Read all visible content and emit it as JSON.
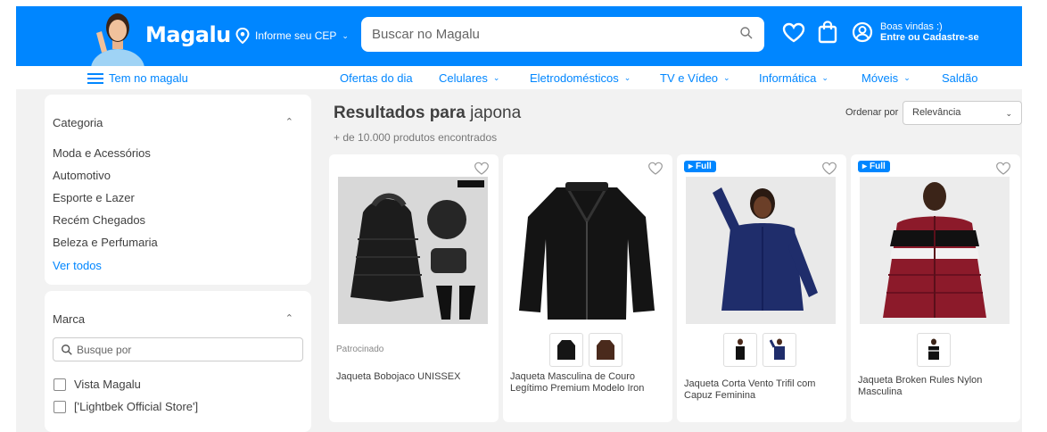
{
  "header": {
    "logo": "Magalu",
    "cep_label": "Informe seu CEP",
    "search_placeholder": "Buscar no Magalu",
    "greeting": "Boas vindas :)",
    "login_label": "Entre ou Cadastre-se",
    "brand_color": "#0086ff"
  },
  "nav": {
    "menu_label": "Tem no magalu",
    "items": [
      "Ofertas do dia",
      "Celulares",
      "Eletrodomésticos",
      "TV e Vídeo",
      "Informática",
      "Móveis",
      "Saldão"
    ]
  },
  "sidebar": {
    "category": {
      "title": "Categoria",
      "items": [
        "Moda e Acessórios",
        "Automotivo",
        "Esporte e Lazer",
        "Recém Chegados",
        "Beleza e Perfumaria"
      ],
      "see_all": "Ver todos"
    },
    "brand": {
      "title": "Marca",
      "search_placeholder": "Busque por",
      "options": [
        "Vista Magalu",
        "['Lightbek Official Store']"
      ]
    }
  },
  "results": {
    "title_prefix": "Resultados para",
    "query": "japona",
    "count": "+ de 10.000 produtos encontrados",
    "sort_label": "Ordenar por",
    "sort_value": "Relevância"
  },
  "products": [
    {
      "name": "Jaqueta Bobojaco UNISSEX",
      "sponsored": "Patrocinado",
      "badge": "",
      "icon": "puffer-jacket-kit-image"
    },
    {
      "name": "Jaqueta Masculina de Couro Legítimo Premium Modelo Iron",
      "sponsored": "",
      "badge": "",
      "icon": "leather-jacket-image"
    },
    {
      "name": "Jaqueta Corta Vento Trifil com Capuz Feminina",
      "sponsored": "",
      "badge": "Full",
      "icon": "windbreaker-image"
    },
    {
      "name": "Jaqueta Broken Rules Nylon Masculina",
      "sponsored": "",
      "badge": "Full",
      "icon": "nylon-jacket-image"
    }
  ]
}
